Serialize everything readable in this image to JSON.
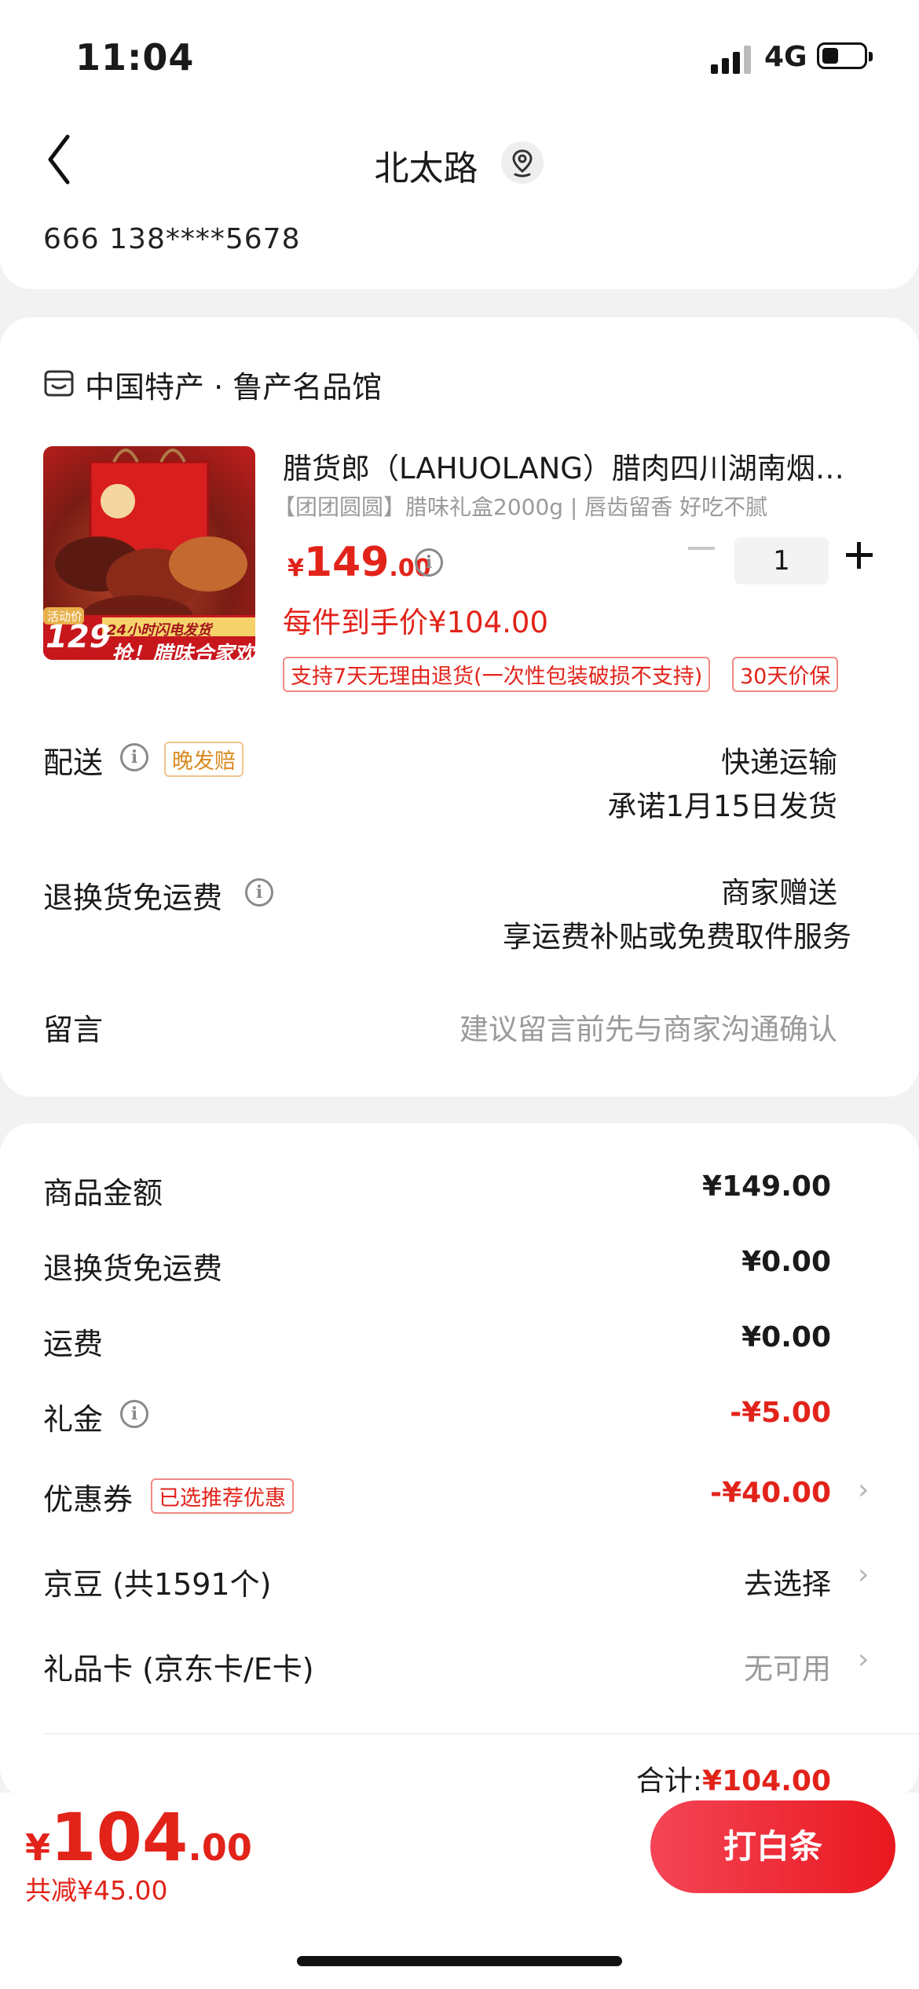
{
  "status_bar": {
    "time": "11:04",
    "network": "4G"
  },
  "address": {
    "title": "北太路",
    "contact": "666  138****5678"
  },
  "shop": {
    "name": "中国特产 · 鲁产名品馆"
  },
  "product": {
    "title": "腊货郎（LAHUOLANG）腊肉四川湖南烟…",
    "subtitle": "【团团圆圆】腊味礼盒2000g | 唇齿留香 好吃不腻",
    "price_symbol": "¥",
    "price_int": "149",
    "price_dec": ".00",
    "quantity": "1",
    "per_item_price": "每件到手价¥104.00",
    "image_badges": {
      "activity": "活动价",
      "price": "129",
      "flash": "24小时闪电发货",
      "slogan": "抢！腊味合家欢"
    },
    "tags": [
      "支持7天无理由退货(一次性包装破损不支持)",
      "30天价保"
    ]
  },
  "delivery": {
    "label": "配送",
    "tag": "晚发赔",
    "method": "快递运输",
    "promise": "承诺1月15日发货"
  },
  "return_shipping": {
    "label": "退换货免运费",
    "value": "商家赠送",
    "value2": "享运费补贴或免费取件服务"
  },
  "message": {
    "label": "留言",
    "placeholder": "建议留言前先与商家沟通确认"
  },
  "summary": {
    "goods_amount_label": "商品金额",
    "goods_amount": "¥149.00",
    "return_free_label": "退换货免运费",
    "return_free": "¥0.00",
    "shipping_label": "运费",
    "shipping": "¥0.00",
    "gift_label": "礼金",
    "gift": "-¥5.00",
    "coupon_label": "优惠券",
    "coupon_tag": "已选推荐优惠",
    "coupon": "-¥40.00",
    "jingdou_label": "京豆 (共1591个)",
    "jingdou": "去选择",
    "giftcard_label": "礼品卡 (京东卡/E卡)",
    "giftcard": "无可用",
    "total_label": "合计:",
    "total": "¥104.00"
  },
  "bottom": {
    "symbol": "¥",
    "price_int": "104",
    "price_dec": ".00",
    "saved": "共减¥45.00",
    "pay_button": "打白条"
  },
  "colors": {
    "accent": "#e2231a",
    "tag_orange": "#d98a1e"
  }
}
